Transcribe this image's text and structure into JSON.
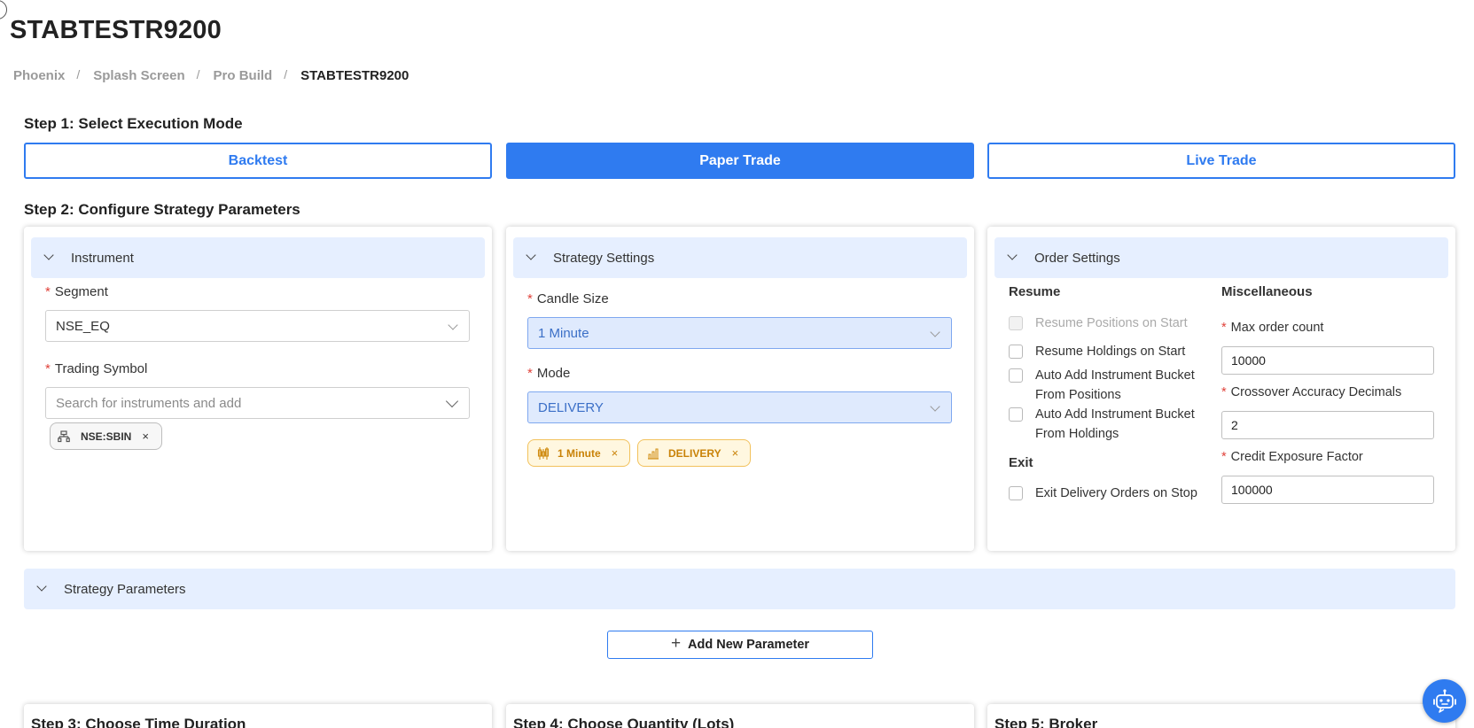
{
  "page": {
    "title": "STABTESTR9200",
    "breadcrumb": [
      "Phoenix",
      "Splash Screen",
      "Pro Build",
      "STABTESTR9200"
    ],
    "separator": "/"
  },
  "step1": {
    "title": "Step 1: Select Execution Mode",
    "modes": [
      {
        "label": "Backtest",
        "active": false
      },
      {
        "label": "Paper Trade",
        "active": true
      },
      {
        "label": "Live Trade",
        "active": false
      }
    ]
  },
  "step2": {
    "title": "Step 2: Configure Strategy Parameters",
    "instrument": {
      "header": "Instrument",
      "segment_label": "Segment",
      "segment_value": "NSE_EQ",
      "symbol_label": "Trading Symbol",
      "symbol_placeholder": "Search for instruments and add",
      "tags": [
        "NSE:SBIN"
      ]
    },
    "strategy_settings": {
      "header": "Strategy Settings",
      "candle_label": "Candle Size",
      "candle_value": "1 Minute",
      "mode_label": "Mode",
      "mode_value": "DELIVERY",
      "tags": [
        "1 Minute",
        "DELIVERY"
      ]
    },
    "order_settings": {
      "header": "Order Settings",
      "resume_title": "Resume",
      "resume_positions": "Resume Positions on Start",
      "resume_holdings": "Resume Holdings on Start",
      "auto_add_positions_1": "Auto Add Instrument Bucket",
      "auto_add_positions_2": "From Positions",
      "auto_add_holdings_1": "Auto Add Instrument Bucket",
      "auto_add_holdings_2": "From Holdings",
      "exit_title": "Exit",
      "exit_delivery": "Exit Delivery Orders on Stop",
      "misc_title": "Miscellaneous",
      "max_order_label": "Max order count",
      "max_order_value": "10000",
      "crossover_label": "Crossover Accuracy Decimals",
      "crossover_value": "2",
      "credit_label": "Credit Exposure Factor",
      "credit_value": "100000"
    },
    "strategy_parameters": {
      "header": "Strategy Parameters",
      "add_button": "Add New Parameter"
    }
  },
  "bottom_steps": [
    "Step 3: Choose Time Duration",
    "Step 4: Choose Quantity (Lots)",
    "Step 5: Broker"
  ],
  "required_mark": "*",
  "tag_close": "×",
  "colors": {
    "primary": "#2f7bf0",
    "header_bg": "#e6efff",
    "required": "#e0423a",
    "tag_orange": "#c98207"
  },
  "icons": [
    "chevron-down-icon",
    "instrument-icon",
    "candlestick-icon",
    "bar-chart-icon",
    "close-icon",
    "plus-icon",
    "robot-assistant-icon"
  ]
}
